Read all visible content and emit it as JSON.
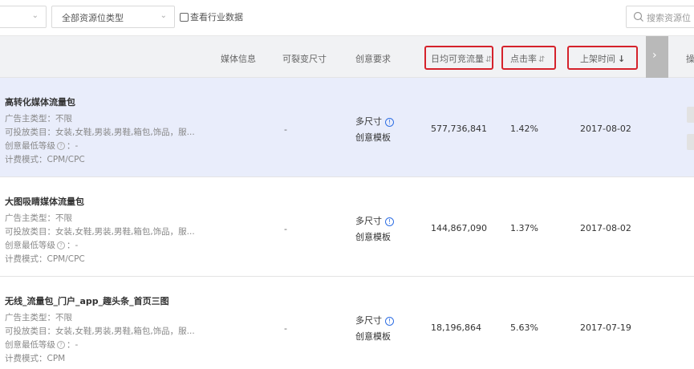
{
  "filters": {
    "first_select": {
      "value": "",
      "chevron_icon": "chevron-down-icon"
    },
    "resource_type_select": {
      "value": "全部资源位类型",
      "chevron_icon": "chevron-down-icon"
    },
    "industry_checkbox": {
      "label": "查看行业数据",
      "checked": false
    }
  },
  "search": {
    "placeholder": "搜索资源位",
    "icon": "search-icon"
  },
  "table": {
    "headers": {
      "media_info": "媒体信息",
      "splittable_size": "可裂变尺寸",
      "creative_req": "创意要求",
      "daily_traffic": "日均可竞流量",
      "ctr": "点击率",
      "listed_time": "上架时间",
      "operation": "操"
    },
    "sort_icons": {
      "daily_traffic": "⇵",
      "ctr": "⇵",
      "listed_time": "↓"
    },
    "next_column_icon": "chevron-right-icon",
    "rows": [
      {
        "name": "高转化媒体流量包",
        "advertiser_type": "广告主类型：不限",
        "categories": "可投放类目：女装,女鞋,男装,男鞋,箱包,饰品，服...",
        "min_level_label": "创意最低等级",
        "min_level_value": "：-",
        "billing": "计费模式：CPM/CPC",
        "split_size": "-",
        "size": "多尺寸",
        "template": "创意模板",
        "daily_traffic": "577,736,841",
        "ctr": "1.42%",
        "listed_time": "2017-08-02"
      },
      {
        "name": "大图吸睛媒体流量包",
        "advertiser_type": "广告主类型：不限",
        "categories": "可投放类目：女装,女鞋,男装,男鞋,箱包,饰品，服...",
        "min_level_label": "创意最低等级",
        "min_level_value": "：-",
        "billing": "计费模式：CPM/CPC",
        "split_size": "-",
        "size": "多尺寸",
        "template": "创意模板",
        "daily_traffic": "144,867,090",
        "ctr": "1.37%",
        "listed_time": "2017-08-02"
      },
      {
        "name": "无线_流量包_门户_app_趣头条_首页三图",
        "advertiser_type": "广告主类型：不限",
        "categories": "可投放类目：女装,女鞋,男装,男鞋,箱包,饰品，服...",
        "min_level_label": "创意最低等级",
        "min_level_value": "：-",
        "billing": "计费模式：CPM",
        "split_size": "-",
        "size": "多尺寸",
        "template": "创意模板",
        "daily_traffic": "18,196,864",
        "ctr": "5.63%",
        "listed_time": "2017-07-19"
      }
    ]
  },
  "colors": {
    "highlight_box": "#d5222b",
    "selected_row_bg": "#e9edfb",
    "header_bg": "#f1f2f4",
    "info_icon": "#2f6fe4"
  }
}
